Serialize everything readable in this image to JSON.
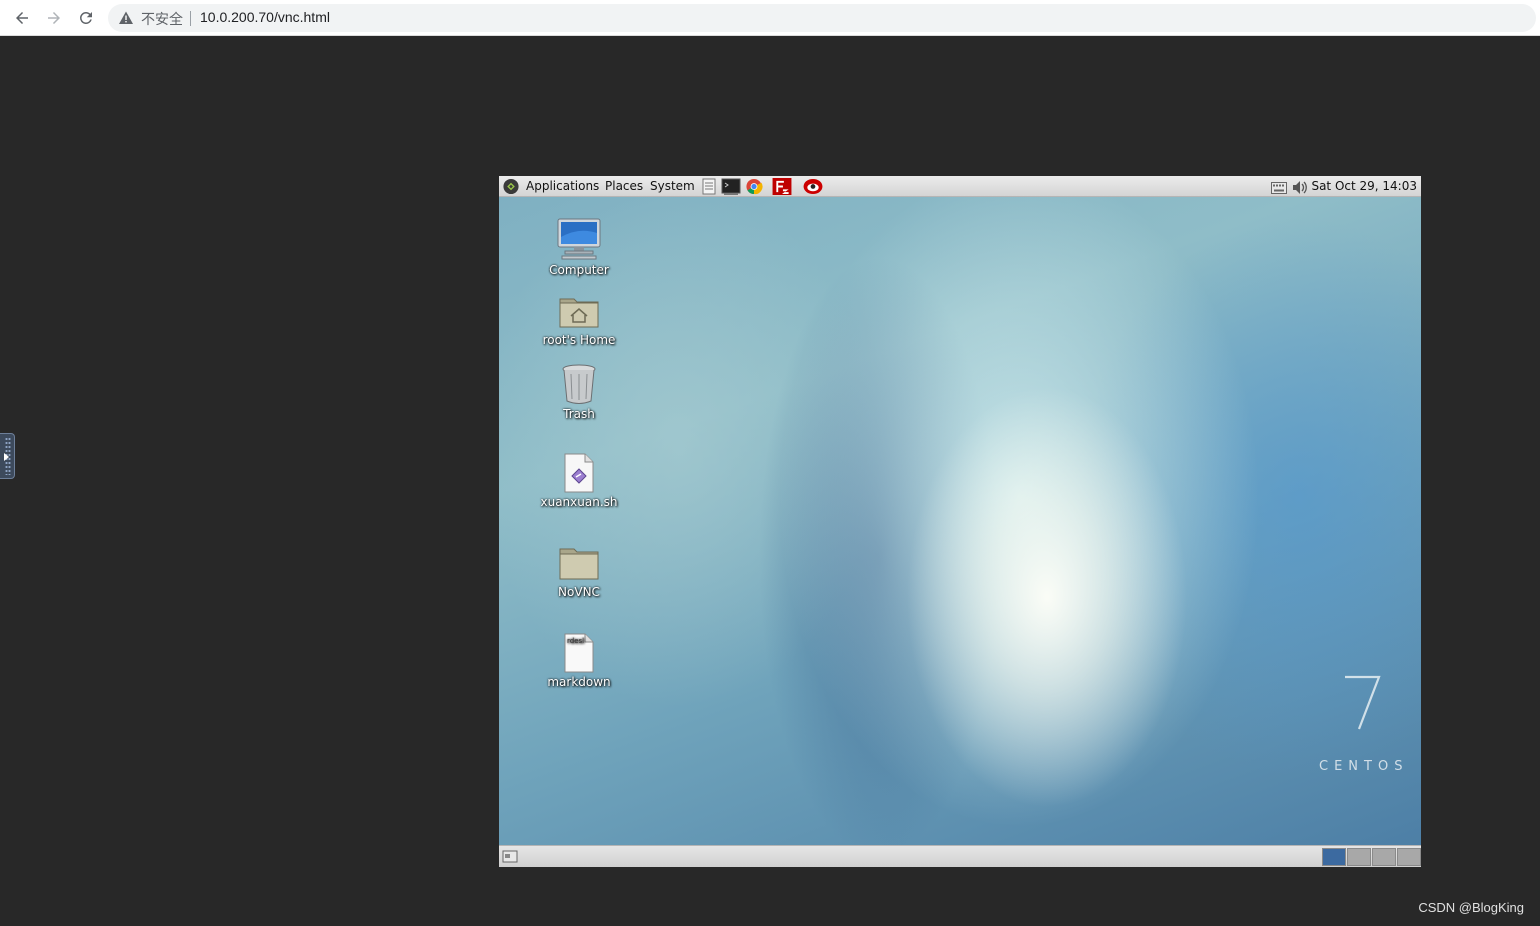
{
  "browser": {
    "security_label": "不安全",
    "url": "10.0.200.70/vnc.html"
  },
  "vnc": {
    "top_panel": {
      "menus": [
        "Applications",
        "Places",
        "System"
      ],
      "launcher_icons": [
        "text-editor-icon",
        "terminal-icon",
        "chrome-icon",
        "filezilla-icon",
        "redhat-icon"
      ],
      "clock": "Sat Oct 29, 14:03"
    },
    "desktop_icons": [
      {
        "label": "Computer",
        "icon": "computer-icon"
      },
      {
        "label": "root's Home",
        "icon": "home-folder-icon"
      },
      {
        "label": "Trash",
        "icon": "trash-icon"
      },
      {
        "label": "xuanxuan.sh",
        "icon": "script-file-icon"
      },
      {
        "label": "NoVNC",
        "icon": "folder-icon"
      },
      {
        "label": "markdown",
        "icon": "text-file-icon",
        "file_thumb_text": "rdesl"
      }
    ],
    "wallpaper": {
      "number": "7",
      "brand": "CENTOS"
    },
    "workspaces": {
      "count": 4,
      "active": 1,
      "active_color": "#3c6aa0",
      "inactive_color": "#a8a8a8"
    }
  },
  "watermark": "CSDN @BlogKing"
}
